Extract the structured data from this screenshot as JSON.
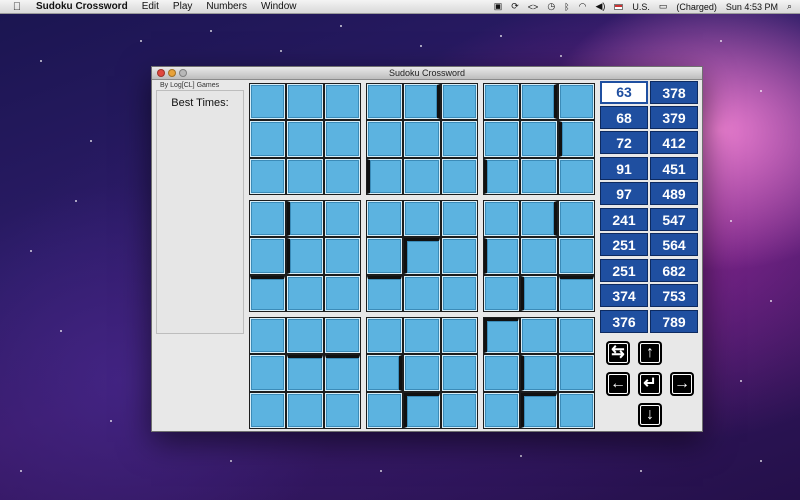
{
  "menubar": {
    "app_name": "Sudoku Crossword",
    "menus": [
      "Edit",
      "Play",
      "Numbers",
      "Window"
    ],
    "input_source": "U.S.",
    "battery": "(Charged)",
    "clock": "Sun 4:53 PM"
  },
  "window": {
    "title": "Sudoku Crossword",
    "byline": "By Log[CL] Games",
    "best_times_label": "Best Times:"
  },
  "numbers": [
    [
      "63",
      "378"
    ],
    [
      "68",
      "379"
    ],
    [
      "72",
      "412"
    ],
    [
      "91",
      "451"
    ],
    [
      "97",
      "489"
    ],
    [
      "241",
      "547"
    ],
    [
      "251",
      "564"
    ],
    [
      "251",
      "682"
    ],
    [
      "374",
      "753"
    ],
    [
      "376",
      "789"
    ]
  ],
  "selected_number": "63",
  "controls": {
    "swap": "⇆",
    "up": "↑",
    "left": "←",
    "enter": "↵",
    "right": "→",
    "down": "↓"
  },
  "colors": {
    "cell": "#5cb3e0",
    "number_tile": "#1f4fa0"
  }
}
